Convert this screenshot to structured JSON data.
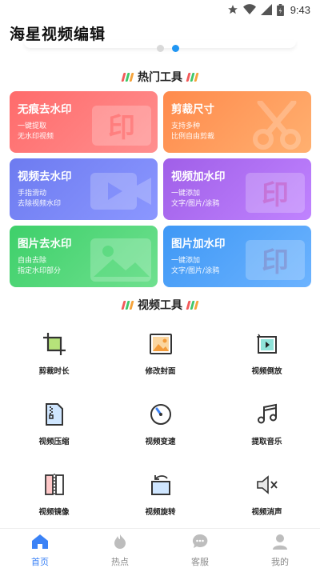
{
  "status_bar": {
    "time": "9:43"
  },
  "app": {
    "title": "海星视频编辑"
  },
  "carousel": {
    "page_count": 2,
    "active_index": 1
  },
  "hot_tools": {
    "title": "热门工具",
    "cards": [
      {
        "title": "无痕去水印",
        "sub1": "一键提取",
        "sub2": "无水印视频",
        "color_start": "#ff6b6b",
        "color_end": "#ff8f8f",
        "icon": "watermark-text-icon"
      },
      {
        "title": "剪裁尺寸",
        "sub1": "支持多种",
        "sub2": "比例自由剪裁",
        "color_start": "#ff8a4c",
        "color_end": "#ffb070",
        "icon": "scissors-icon"
      },
      {
        "title": "视频去水印",
        "sub1": "手指滑动",
        "sub2": "去除视频水印",
        "color_start": "#6d7bf0",
        "color_end": "#8b97ff",
        "icon": "video-camera-icon"
      },
      {
        "title": "视频加水印",
        "sub1": "一键添加",
        "sub2": "文字/图片/涂鸦",
        "color_start": "#a05fe8",
        "color_end": "#c083ff",
        "icon": "watermark-text-icon"
      },
      {
        "title": "图片去水印",
        "sub1": "自由去除",
        "sub2": "指定水印部分",
        "color_start": "#3ed06a",
        "color_end": "#6fe08f",
        "icon": "image-icon"
      },
      {
        "title": "图片加水印",
        "sub1": "一键添加",
        "sub2": "文字/图片/涂鸦",
        "color_start": "#3f98f5",
        "color_end": "#6cb3ff",
        "icon": "watermark-text-icon"
      }
    ]
  },
  "video_tools": {
    "title": "视频工具",
    "items": [
      {
        "label": "剪裁时长",
        "icon": "crop-icon"
      },
      {
        "label": "修改封面",
        "icon": "cover-image-icon"
      },
      {
        "label": "视频倒放",
        "icon": "reverse-play-icon"
      },
      {
        "label": "视频压缩",
        "icon": "compress-file-icon"
      },
      {
        "label": "视频变速",
        "icon": "speedometer-icon"
      },
      {
        "label": "提取音乐",
        "icon": "music-note-icon"
      },
      {
        "label": "视频镜像",
        "icon": "mirror-icon"
      },
      {
        "label": "视频旋转",
        "icon": "rotate-icon"
      },
      {
        "label": "视频消声",
        "icon": "mute-icon"
      }
    ]
  },
  "bottom_nav": {
    "items": [
      {
        "label": "首页",
        "icon": "home-icon",
        "active": true
      },
      {
        "label": "热点",
        "icon": "flame-icon",
        "active": false
      },
      {
        "label": "客服",
        "icon": "chat-bubble-icon",
        "active": false
      },
      {
        "label": "我的",
        "icon": "user-icon",
        "active": false
      }
    ]
  },
  "colors": {
    "accent": "#3b82f6",
    "dot_active": "#2196f3",
    "stripe_red": "#f25a5a",
    "stripe_green": "#3fc76a",
    "stripe_orange": "#f5a33b"
  }
}
